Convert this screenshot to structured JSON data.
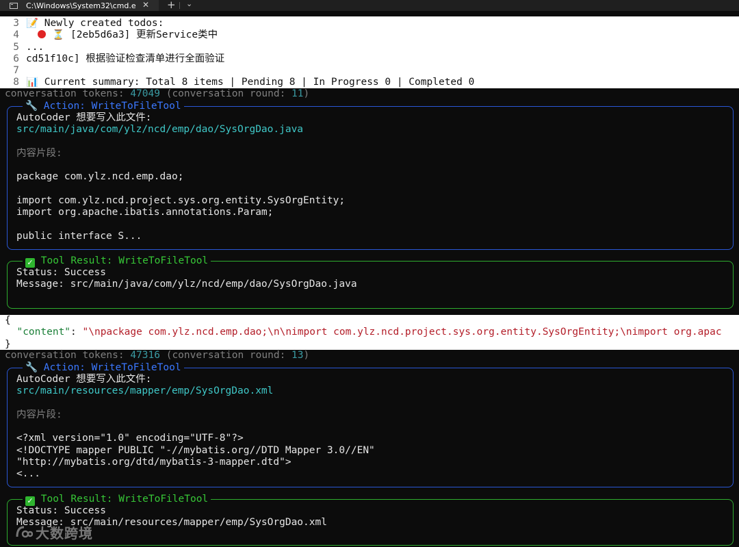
{
  "tab": {
    "title": "C:\\Windows\\System32\\cmd.ex",
    "close_glyph": "✕",
    "new_tab_glyph": "+",
    "dropdown_glyph": "⌄"
  },
  "header_lines": [
    {
      "num": "3",
      "text": "Newly created todos:"
    },
    {
      "num": "4",
      "text": "[2eb5d6a3] 更新Service类中"
    },
    {
      "num": "5",
      "text": "..."
    },
    {
      "num": "6",
      "text": "cd51f10c] 根据验证检查清单进行全面验证"
    },
    {
      "num": "7",
      "text": ""
    },
    {
      "num": "8",
      "text": "Current summary: Total 8 items | Pending 8 | In Progress 0 | Completed 0"
    }
  ],
  "tokens1": {
    "label": "conversation tokens: ",
    "count": "47049",
    "round_label": " (conversation round: ",
    "round": "11",
    "close": ")"
  },
  "action1": {
    "title": "Action: WriteToFileTool",
    "intro": "AutoCoder 想要写入此文件:",
    "path": "src/main/java/com/ylz/ncd/emp/dao/SysOrgDao.java",
    "snippet_label": "内容片段:",
    "lines": [
      "package com.ylz.ncd.emp.dao;",
      "",
      "import com.ylz.ncd.project.sys.org.entity.SysOrgEntity;",
      "import org.apache.ibatis.annotations.Param;",
      "",
      "public interface S..."
    ]
  },
  "result1": {
    "title": "Tool Result: WriteToFileTool",
    "status_label": "Status: ",
    "status": "Success",
    "message_label": "Message: ",
    "message": "src/main/java/com/ylz/ncd/emp/dao/SysOrgDao.java"
  },
  "json_block": {
    "open": "{",
    "key": "\"content\"",
    "colon": ": ",
    "value": "\"\\npackage com.ylz.ncd.emp.dao;\\n\\nimport com.ylz.ncd.project.sys.org.entity.SysOrgEntity;\\nimport org.apac",
    "close": "}"
  },
  "tokens2": {
    "label": "conversation tokens: ",
    "count": "47316",
    "round_label": " (conversation round: ",
    "round": "13",
    "close": ")"
  },
  "action2": {
    "title": "Action: WriteToFileTool",
    "intro": "AutoCoder 想要写入此文件:",
    "path": "src/main/resources/mapper/emp/SysOrgDao.xml",
    "snippet_label": "内容片段:",
    "lines": [
      "<?xml version=\"1.0\" encoding=\"UTF-8\"?>",
      "<!DOCTYPE mapper PUBLIC \"-//mybatis.org//DTD Mapper 3.0//EN\"",
      "\"http://mybatis.org/dtd/mybatis-3-mapper.dtd\">",
      "<..."
    ]
  },
  "result2": {
    "title": "Tool Result: WriteToFileTool",
    "status_label": "Status: ",
    "status": "Success",
    "message_label": "Message: ",
    "message": "src/main/resources/mapper/emp/SysOrgDao.xml"
  },
  "watermark": {
    "text": "大数跨境"
  },
  "colors": {
    "background": "#0c0c0c",
    "action_border": "#2a57d6",
    "result_border": "#2fae2f",
    "path_cyan": "#3fc7c7"
  }
}
